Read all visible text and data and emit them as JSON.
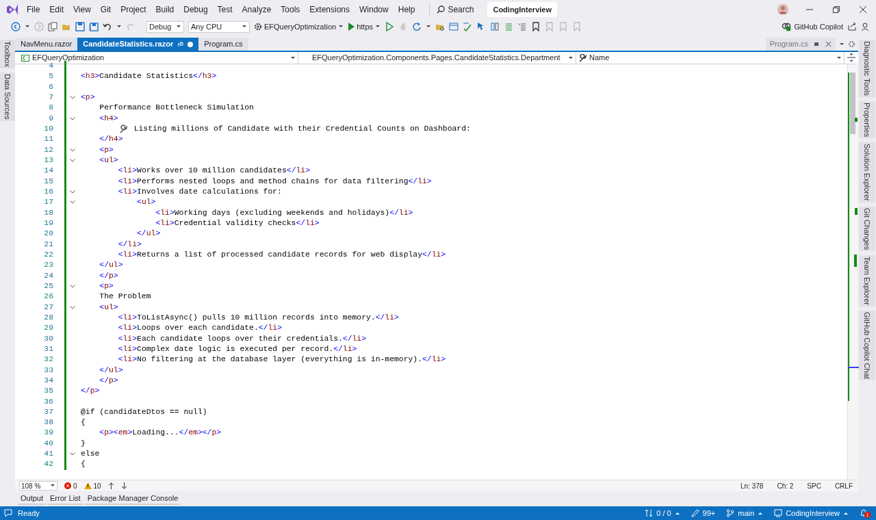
{
  "menu": [
    "File",
    "Edit",
    "View",
    "Git",
    "Project",
    "Build",
    "Debug",
    "Test",
    "Analyze",
    "Tools",
    "Extensions",
    "Window",
    "Help"
  ],
  "search": {
    "label": "Search"
  },
  "solution_name": "CodingInterview",
  "toolbar": {
    "configuration": "Debug",
    "platform": "Any CPU",
    "startup_project": "EFQueryOptimization",
    "launch_profile": "https",
    "copilot": "GitHub Copilot"
  },
  "tabs": [
    {
      "label": "NavMenu.razor",
      "selected": false,
      "modified": false
    },
    {
      "label": "CandidateStatistics.razor",
      "selected": true,
      "modified": true
    },
    {
      "label": "Program.cs",
      "selected": false,
      "modified": false
    }
  ],
  "preview_tab": {
    "label": "Program.cs"
  },
  "navigation_bar": {
    "project": "EFQueryOptimization",
    "type": "EFQueryOptimization.Components.Pages.CandidateStatistics.Department",
    "member": "Name"
  },
  "left_tool_windows": [
    "Toolbox",
    "Data Sources"
  ],
  "right_tool_windows": [
    "Diagnostic Tools",
    "Properties",
    "Solution Explorer",
    "Git Changes",
    "Team Explorer",
    "GitHub Copilot Chat"
  ],
  "code_lines": [
    {
      "n": "4",
      "fold": false
    },
    {
      "n": "5",
      "fold": false,
      "code": "<h3>Candidate Statistics</h3>"
    },
    {
      "n": "6",
      "fold": false
    },
    {
      "n": "7",
      "fold": true,
      "code": "<p>"
    },
    {
      "n": "8",
      "fold": false,
      "code": "    Performance Bottleneck Simulation"
    },
    {
      "n": "9",
      "fold": true,
      "code": "    <h4>"
    },
    {
      "n": "10",
      "fold": false,
      "leading_icon": true,
      "code": "        Listing millions of Candidate with their Credential Counts on Dashboard:"
    },
    {
      "n": "11",
      "fold": false,
      "code": "    </h4>"
    },
    {
      "n": "12",
      "fold": true,
      "code": "    <p>"
    },
    {
      "n": "13",
      "fold": true,
      "code": "    <ul>"
    },
    {
      "n": "14",
      "fold": false,
      "code": "        <li>Works over 10 million candidates</li>"
    },
    {
      "n": "15",
      "fold": false,
      "code": "        <li>Performs nested loops and method chains for data filtering</li>"
    },
    {
      "n": "16",
      "fold": true,
      "code": "        <li>Involves date calculations for:"
    },
    {
      "n": "17",
      "fold": true,
      "code": "            <ul>"
    },
    {
      "n": "18",
      "fold": false,
      "code": "                <li>Working days (excluding weekends and holidays)</li>"
    },
    {
      "n": "19",
      "fold": false,
      "code": "                <li>Credential validity checks</li>"
    },
    {
      "n": "20",
      "fold": false,
      "code": "            </ul>"
    },
    {
      "n": "21",
      "fold": false,
      "code": "        </li>"
    },
    {
      "n": "22",
      "fold": false,
      "code": "        <li>Returns a list of processed candidate records for web display</li>"
    },
    {
      "n": "23",
      "fold": false,
      "code": "    </ul>"
    },
    {
      "n": "24",
      "fold": false,
      "code": "    </p>"
    },
    {
      "n": "25",
      "fold": true,
      "code": "    <p>"
    },
    {
      "n": "26",
      "fold": false,
      "code": "    The Problem"
    },
    {
      "n": "27",
      "fold": true,
      "code": "    <ul>"
    },
    {
      "n": "28",
      "fold": false,
      "code": "        <li>ToListAsync() pulls 10 million records into memory.</li>"
    },
    {
      "n": "29",
      "fold": false,
      "code": "        <li>Loops over each candidate.</li>"
    },
    {
      "n": "30",
      "fold": false,
      "code": "        <li>Each candidate loops over their credentials.</li>"
    },
    {
      "n": "31",
      "fold": false,
      "code": "        <li>Complex date logic is executed per record.</li>"
    },
    {
      "n": "32",
      "fold": false,
      "code": "        <li>No filtering at the database layer (everything is in-memory).</li>"
    },
    {
      "n": "33",
      "fold": false,
      "code": "    </ul>"
    },
    {
      "n": "34",
      "fold": false,
      "code": "    </p>"
    },
    {
      "n": "35",
      "fold": false,
      "code": "</p>"
    },
    {
      "n": "36",
      "fold": false
    },
    {
      "n": "37",
      "fold": false,
      "code": "@if (candidateDtos == null)"
    },
    {
      "n": "38",
      "fold": false,
      "code": "{"
    },
    {
      "n": "39",
      "fold": false,
      "code": "    <p><em>Loading...</em></p>"
    },
    {
      "n": "40",
      "fold": false,
      "code": "}"
    },
    {
      "n": "41",
      "fold": true,
      "code": "else"
    },
    {
      "n": "42",
      "fold": false,
      "code": "{"
    }
  ],
  "editor_status": {
    "zoom": "108 %",
    "errors": "0",
    "warnings": "10",
    "line": "Ln: 378",
    "column": "Ch: 2",
    "whitespace": "SPC",
    "line_endings": "CRLF"
  },
  "bottom_tabs": [
    "Output",
    "Error List",
    "Package Manager Console"
  ],
  "status_bar": {
    "message": "Ready",
    "commits": "0 / 0",
    "changes": "99+",
    "branch": "main",
    "repository": "CodingInterview",
    "notifications": "1"
  }
}
